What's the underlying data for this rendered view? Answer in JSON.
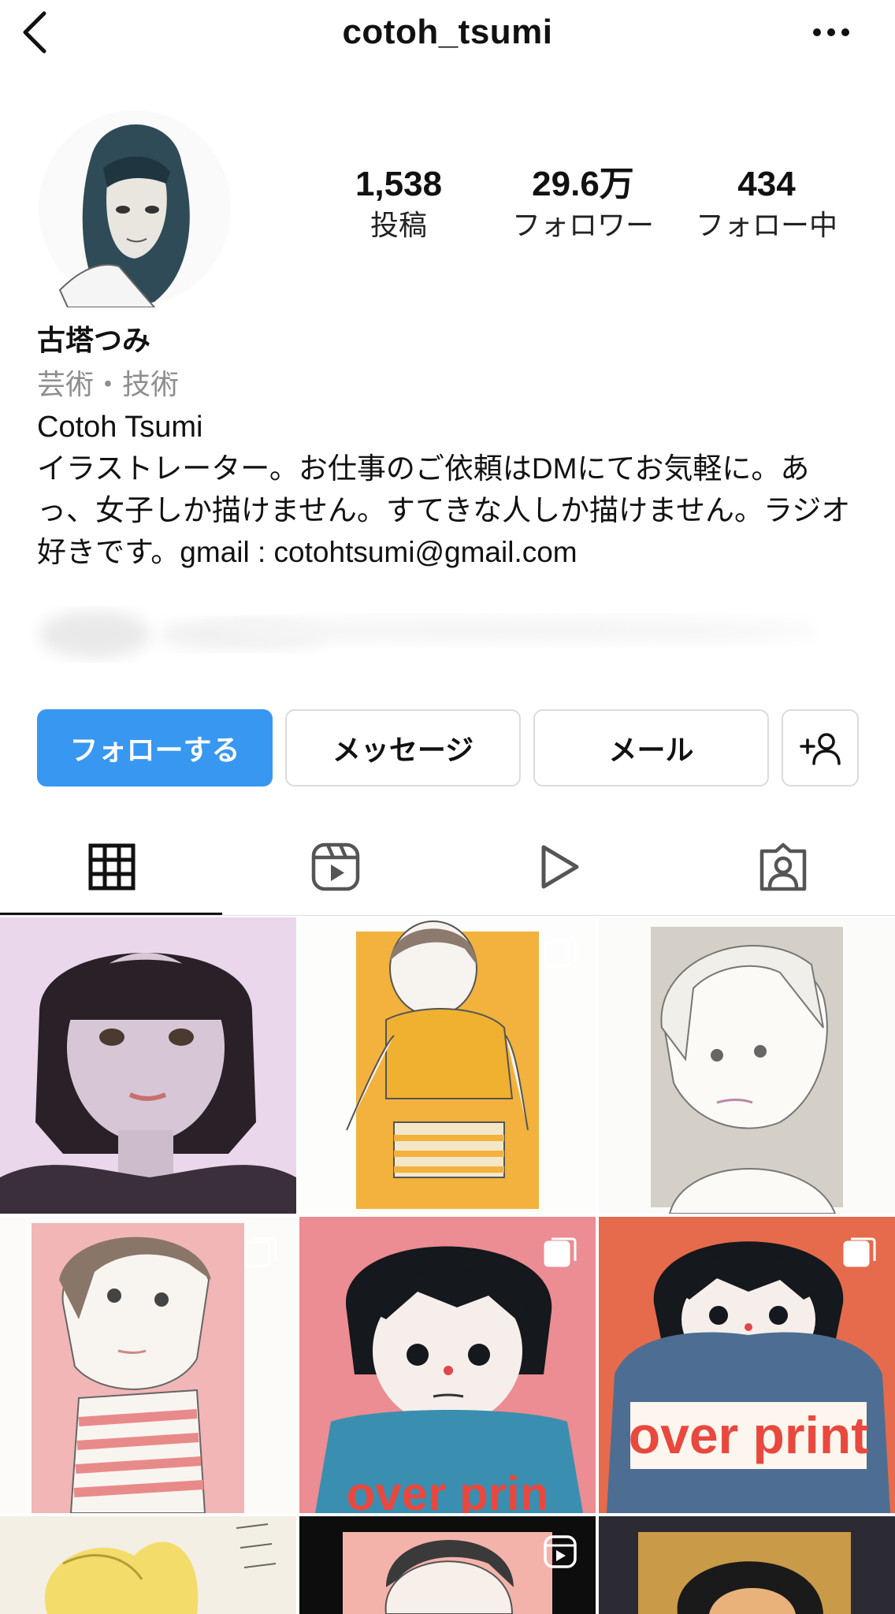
{
  "header": {
    "username": "cotoh_tsumi",
    "back_icon": "chevron-left-icon",
    "more_icon": "more-horizontal-icon"
  },
  "stats": {
    "posts": {
      "value": "1,538",
      "label": "投稿"
    },
    "followers": {
      "value": "29.6万",
      "label": "フォロワー"
    },
    "following": {
      "value": "434",
      "label": "フォロー中"
    }
  },
  "profile": {
    "display_name": "古塔つみ",
    "category": "芸術・技術",
    "name_en": "Cotoh Tsumi",
    "bio": "イラストレーター。お仕事のご依頼はDMにてお気軽に。あっ、女子しか描けません。すてきな人しか描けません。ラジオ好きです。gmail : cotohtsumi@gmail.com"
  },
  "actions": {
    "follow": "フォローする",
    "message": "メッセージ",
    "mail": "メール",
    "suggest_icon": "add-person-icon"
  },
  "tabs": [
    "grid-icon",
    "reels-icon",
    "video-play-icon",
    "tagged-person-icon"
  ],
  "colors": {
    "accent": "#3897f0",
    "border": "#dbdbdb",
    "muted": "#8e8e8e"
  },
  "grid_overlay_text": {
    "tile5": "over prin",
    "tile6": "over print"
  }
}
